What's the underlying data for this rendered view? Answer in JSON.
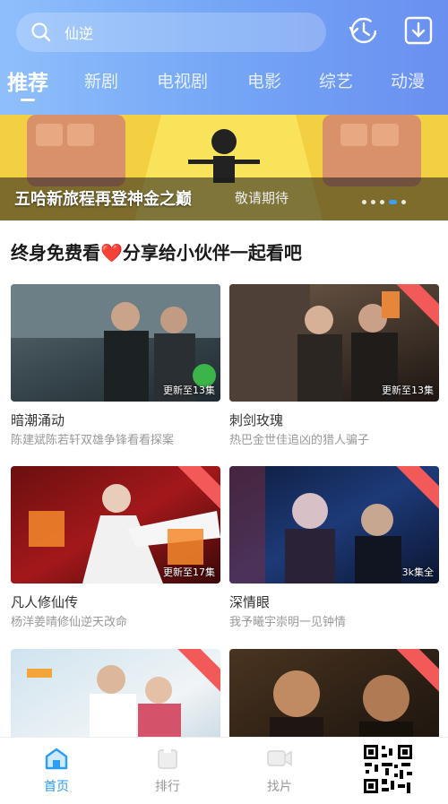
{
  "search": {
    "placeholder": "仙逆"
  },
  "header_icons": [
    "history-icon",
    "download-icon"
  ],
  "tabs": [
    {
      "label": "推荐",
      "active": true
    },
    {
      "label": "新剧"
    },
    {
      "label": "电视剧"
    },
    {
      "label": "电影"
    },
    {
      "label": "综艺"
    },
    {
      "label": "动漫"
    }
  ],
  "banner": {
    "title": "五哈新旅程再登神金之巅",
    "subtitle": "敬请期待"
  },
  "section": {
    "title": "终身免费看❤️分享给小伙伴一起看吧"
  },
  "cards": [
    {
      "title": "暗潮涌动",
      "desc": "陈建斌陈若轩双雄争锋看看探案",
      "ep": "更新至13集"
    },
    {
      "title": "刺剑玫瑰",
      "desc": "热巴金世佳追凶的猎人骗子",
      "ep": "更新至13集"
    },
    {
      "title": "凡人修仙传",
      "desc": "杨洋姜晴修仙逆天改命",
      "ep": "更新至17集"
    },
    {
      "title": "深情眼",
      "desc": "我予曦宇崇明一见钟情",
      "ep": "3k集全"
    },
    {
      "title": "",
      "desc": "",
      "ep": ""
    },
    {
      "title": "",
      "desc": "",
      "ep": ""
    }
  ],
  "bottom_nav": [
    {
      "label": "首页",
      "active": true
    },
    {
      "label": "排行"
    },
    {
      "label": "找片"
    }
  ],
  "colors": {
    "accent": "#2a9df4",
    "header_start": "#8fbffb",
    "header_end": "#6a8ff0",
    "badge": "#f25a5a"
  }
}
